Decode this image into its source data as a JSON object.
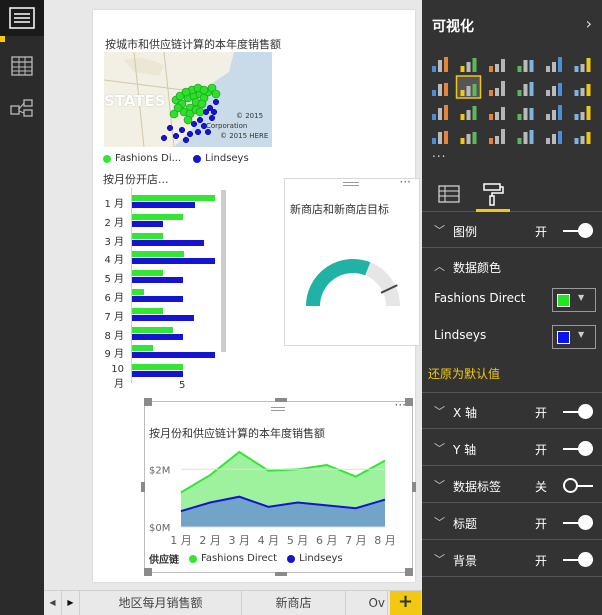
{
  "visualizations": {
    "map_title": "按城市和供应链计算的本年度销售额",
    "map_text": "STATES",
    "map_copyright_1": "© 2015",
    "map_copyright_2": "Corporation",
    "map_copyright_3": "© 2015 HERE",
    "legend": [
      "Fashions Di...",
      "Lindseys"
    ],
    "bar_title": "按月份开店...",
    "bar_data": {
      "type": "bar",
      "categories": [
        "1 月",
        "2 月",
        "3 月",
        "4 月",
        "5 月",
        "6 月",
        "7 月",
        "8 月",
        "9 月",
        "10 月"
      ],
      "series": [
        {
          "name": "Fashions Direct",
          "values": [
            8.3,
            5.1,
            3.1,
            5.2,
            3.1,
            1.2,
            3.1,
            4.1,
            2.1,
            5.1
          ]
        },
        {
          "name": "Lindseys",
          "values": [
            6.3,
            3.1,
            7.2,
            8.3,
            5.1,
            5.1,
            6.2,
            5.1,
            8.3,
            5.1
          ]
        }
      ],
      "axis_tick": "5",
      "colors": [
        "#33e633",
        "#1414d2"
      ]
    },
    "gauge_title": "新商店和新商店目标",
    "gauge": {
      "value_fraction": 0.62,
      "target_fraction": 0.86,
      "fill_color": "#20b2a4"
    },
    "area_title": "按月份和供应链计算的本年度销售额",
    "area_legend_title": "供应链",
    "area_legend": [
      "Fashions Direct",
      "Lindseys"
    ],
    "chart_data": {
      "type": "area",
      "categories": [
        "1 月",
        "2 月",
        "3 月",
        "4 月",
        "5 月",
        "6 月",
        "7 月",
        "8 月"
      ],
      "series": [
        {
          "name": "Fashions Direct",
          "values": [
            1.2,
            1.8,
            2.6,
            1.95,
            2.0,
            2.15,
            1.75,
            2.3
          ]
        },
        {
          "name": "Lindseys",
          "values": [
            0.55,
            0.85,
            1.05,
            0.7,
            0.85,
            0.75,
            0.65,
            0.95
          ]
        }
      ],
      "yticks": [
        "$2M",
        "$0M"
      ],
      "ylim": [
        0,
        2.6
      ],
      "colors": [
        "#33e633",
        "#1414d2"
      ]
    }
  },
  "tabs": [
    {
      "label": "地区每月销售额"
    },
    {
      "label": "新商店"
    },
    {
      "label": "Ov"
    }
  ],
  "add_tab": "+",
  "pane": {
    "title": "可视化",
    "sections": [
      {
        "label": "图例",
        "state": "开",
        "on": true,
        "expanded": false
      },
      {
        "label": "数据颜色",
        "state": "",
        "on": null,
        "expanded": true
      }
    ],
    "colors": [
      {
        "label": "Fashions Direct",
        "color": "#1fe81f"
      },
      {
        "label": "Lindseys",
        "color": "#0b13f0"
      }
    ],
    "restore": "还原为默认值",
    "more_sections": [
      {
        "label": "X 轴",
        "state": "开",
        "on": true
      },
      {
        "label": "Y 轴",
        "state": "开",
        "on": true
      },
      {
        "label": "数据标签",
        "state": "关",
        "on": false
      },
      {
        "label": "标题",
        "state": "开",
        "on": true
      },
      {
        "label": "背景",
        "state": "开",
        "on": true
      }
    ],
    "more": "..."
  },
  "accent": "#f2c811"
}
